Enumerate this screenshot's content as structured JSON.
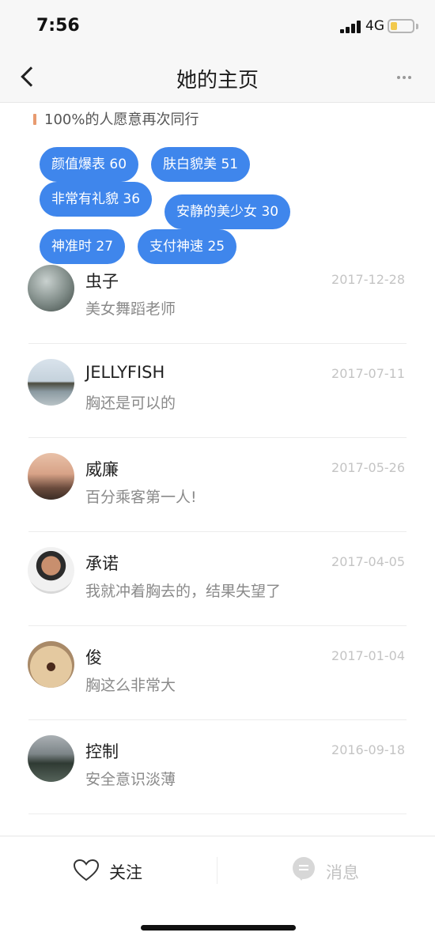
{
  "status_bar": {
    "time": "7:56",
    "network": "4G"
  },
  "nav": {
    "title": "她的主页",
    "back_icon": "chevron-left-icon",
    "more_icon": "more-dots-icon"
  },
  "recommend": {
    "text": "100%的人愿意再次同行",
    "accent_color": "#e89b70"
  },
  "tags": {
    "color": "#3f86ec",
    "rows": [
      [
        "颜值爆表 60",
        "肤白貌美 51",
        "非常有礼貌 36"
      ],
      [
        "安静的美少女 30",
        "神准时 27",
        "支付神速 25"
      ]
    ]
  },
  "comments": [
    {
      "name": "虫子",
      "date": "2017-12-28",
      "text": "美女舞蹈老师",
      "avatar": "rain-window-photo"
    },
    {
      "name": "JELLYFISH",
      "date": "2017-07-11",
      "text": "胸还是可以的",
      "avatar": "palace-landscape-photo"
    },
    {
      "name": "威廉",
      "date": "2017-05-26",
      "text": "百分乘客第一人!",
      "avatar": "sunset-city-photo"
    },
    {
      "name": "承诺",
      "date": "2017-04-05",
      "text": "我就冲着胸去的，结果失望了",
      "avatar": "man-portrait-photo"
    },
    {
      "name": "俊",
      "date": "2017-01-04",
      "text": "胸这么非常大",
      "avatar": "dog-face-photo"
    },
    {
      "name": "控制",
      "date": "2016-09-18",
      "text": "安全意识淡薄",
      "avatar": "tennis-court-photo"
    }
  ],
  "bottom_bar": {
    "follow_label": "关注",
    "follow_icon": "heart-icon",
    "message_label": "消息",
    "message_icon": "chat-bubble-icon"
  }
}
